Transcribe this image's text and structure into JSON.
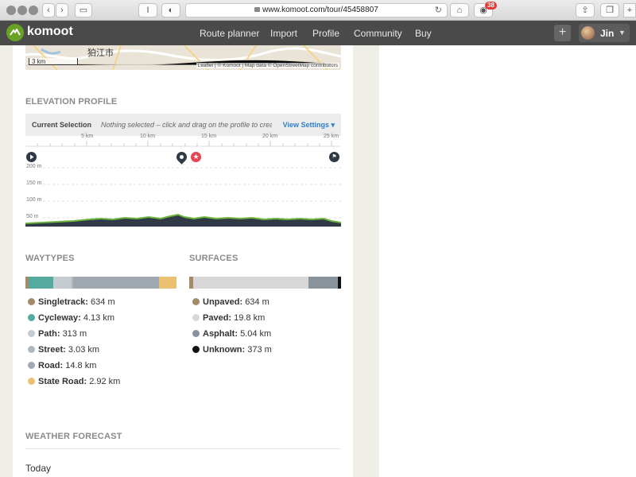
{
  "browser": {
    "url": "www.komoot.com/tour/45458807",
    "extension_badge": "38",
    "reader_label": "I"
  },
  "header": {
    "brand": "komoot",
    "nav": [
      "Route planner",
      "Import",
      "Profile",
      "Community",
      "Buy"
    ],
    "add_label": "+",
    "user_name": "Jin"
  },
  "map": {
    "place_label": "狛江市",
    "scale_label": "3 km",
    "attribution": "Leaflet | © Komoot | Map data © OpenStreetMap contributors"
  },
  "elevation": {
    "title": "ELEVATION PROFILE",
    "selection_label": "Current Selection",
    "selection_text": "Nothing selected – click and drag on the profile to create",
    "settings_label": "View Settings",
    "x_ticks": [
      "5 km",
      "10 km",
      "15 km",
      "20 km",
      "25 km"
    ],
    "y_ticks": [
      "200 m",
      "150 m",
      "100 m",
      "50 m"
    ]
  },
  "waytypes": {
    "title": "WAYTYPES",
    "items": [
      {
        "label": "Singletrack:",
        "value": "634 m",
        "color": "#a58a6a",
        "share": 0.022
      },
      {
        "label": "Cycleway:",
        "value": "4.13 km",
        "color": "#55aaa0",
        "share": 0.16
      },
      {
        "label": "Path:",
        "value": "313 m",
        "color": "#c4cbd1",
        "share": 0.12
      },
      {
        "label": "Street:",
        "value": "3.03 km",
        "color": "#b0b8bf",
        "share": 0.05
      },
      {
        "label": "Road:",
        "value": "14.8 km",
        "color": "#a0a9b2",
        "share": 0.53
      },
      {
        "label": "State Road:",
        "value": "2.92 km",
        "color": "#e9c170",
        "share": 0.118
      }
    ]
  },
  "surfaces": {
    "title": "SURFACES",
    "items": [
      {
        "label": "Unpaved:",
        "value": "634 m",
        "color": "#a58a6a",
        "share": 0.022
      },
      {
        "label": "Paved:",
        "value": "19.8 km",
        "color": "#d7d7d7",
        "share": 0.76
      },
      {
        "label": "Asphalt:",
        "value": "5.04 km",
        "color": "#89939c",
        "share": 0.19
      },
      {
        "label": "Unknown:",
        "value": "373 m",
        "color": "#111111",
        "share": 0.016
      }
    ]
  },
  "weather": {
    "title": "WEATHER FORECAST",
    "today_label": "Today"
  }
}
